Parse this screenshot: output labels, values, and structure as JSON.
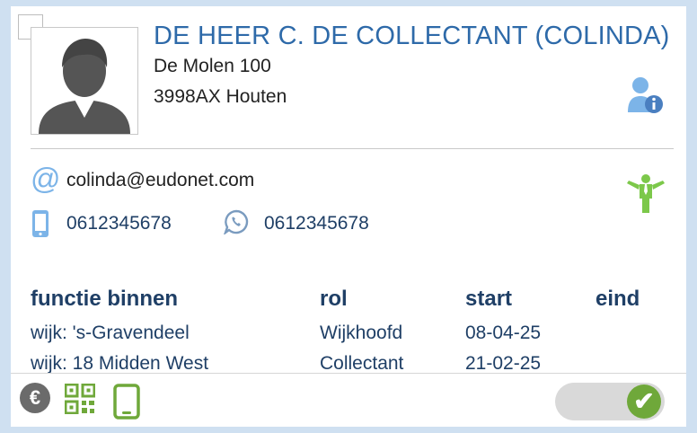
{
  "contact": {
    "name": "DE HEER C. DE COLLECTANT (COLINDA)",
    "street": "De Molen 100",
    "city": "3998AX Houten",
    "email_symbol": "@",
    "email": "colinda@eudonet.com",
    "mobile": "0612345678",
    "whatsapp": "0612345678"
  },
  "roles_table": {
    "headers": [
      "functie binnen",
      "rol",
      "start",
      "eind"
    ],
    "rows": [
      {
        "functie": "wijk: 's-Gravendeel",
        "rol": "Wijkhoofd",
        "start": "08-04-25",
        "eind": ""
      },
      {
        "functie": "wijk: 18 Midden West",
        "rol": "Collectant",
        "start": "21-02-25",
        "eind": ""
      }
    ]
  },
  "footer": {
    "euro_symbol": "€",
    "toggle_check": "✔",
    "toggle_on": true
  },
  "colors": {
    "accent_blue": "#2e6aa9",
    "dark_blue_text": "#1f3f66",
    "green": "#6fa83a",
    "light_green": "#7cc84a",
    "icon_light_blue": "#7cb4e8",
    "background": "#cfe0f1"
  },
  "icons": [
    "checkbox",
    "avatar-placeholder-icon",
    "person-info-icon",
    "at-icon",
    "green-person-icon",
    "mobile-phone-icon",
    "whatsapp-icon",
    "euro-icon",
    "qr-code-icon",
    "mobile-device-icon",
    "check-icon"
  ]
}
